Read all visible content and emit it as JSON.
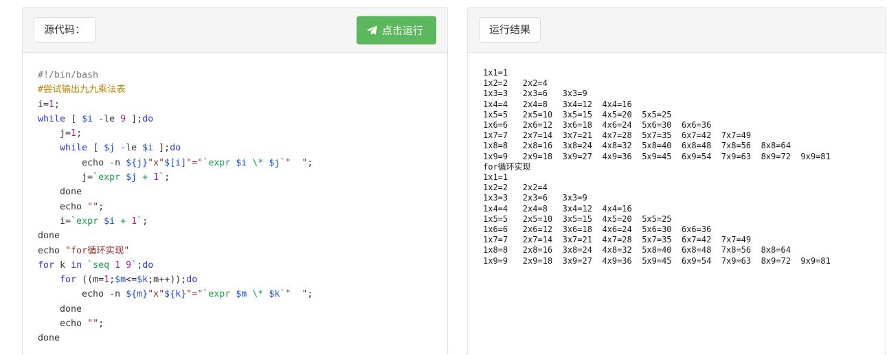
{
  "left_panel": {
    "header_label": "源代码：",
    "run_button": {
      "label": "点击运行",
      "icon": "paper-plane-icon",
      "color": "#5cb85c"
    },
    "code_lines": [
      {
        "indent": 0,
        "tokens": [
          {
            "t": "#!/bin/bash",
            "c": "cm1"
          }
        ]
      },
      {
        "indent": 0,
        "tokens": [
          {
            "t": "#尝试输出九九乘法表",
            "c": "cm"
          }
        ]
      },
      {
        "indent": 0,
        "tokens": [
          {
            "t": "i=",
            "c": "op"
          },
          {
            "t": "1",
            "c": "num"
          },
          {
            "t": ";",
            "c": "op"
          }
        ]
      },
      {
        "indent": 0,
        "tokens": [
          {
            "t": "while",
            "c": "k"
          },
          {
            "t": " [ ",
            "c": "op"
          },
          {
            "t": "$i",
            "c": "var"
          },
          {
            "t": " -le ",
            "c": "op"
          },
          {
            "t": "9",
            "c": "num"
          },
          {
            "t": " ];",
            "c": "op"
          },
          {
            "t": "do",
            "c": "k"
          }
        ]
      },
      {
        "indent": 1,
        "tokens": [
          {
            "t": "j=",
            "c": "op"
          },
          {
            "t": "1",
            "c": "num"
          },
          {
            "t": ";",
            "c": "op"
          }
        ]
      },
      {
        "indent": 1,
        "tokens": [
          {
            "t": "while",
            "c": "k"
          },
          {
            "t": " [ ",
            "c": "op"
          },
          {
            "t": "$j",
            "c": "var"
          },
          {
            "t": " -le ",
            "c": "op"
          },
          {
            "t": "$i",
            "c": "var"
          },
          {
            "t": " ];",
            "c": "op"
          },
          {
            "t": "do",
            "c": "k"
          }
        ]
      },
      {
        "indent": 2,
        "tokens": [
          {
            "t": "echo",
            "c": "op"
          },
          {
            "t": " -n ",
            "c": "op"
          },
          {
            "t": "${j}",
            "c": "var"
          },
          {
            "t": "\"x\"",
            "c": "str"
          },
          {
            "t": "$[i]",
            "c": "var"
          },
          {
            "t": "\"=\"",
            "c": "str"
          },
          {
            "t": "`expr ",
            "c": "bq"
          },
          {
            "t": "$i",
            "c": "var"
          },
          {
            "t": " \\* ",
            "c": "bq"
          },
          {
            "t": "$j",
            "c": "var"
          },
          {
            "t": "`",
            "c": "bq"
          },
          {
            "t": "\"  \"",
            "c": "str"
          },
          {
            "t": ";",
            "c": "op"
          }
        ]
      },
      {
        "indent": 2,
        "tokens": [
          {
            "t": "j=",
            "c": "op"
          },
          {
            "t": "`expr ",
            "c": "bq"
          },
          {
            "t": "$j",
            "c": "var"
          },
          {
            "t": " + ",
            "c": "bq"
          },
          {
            "t": "1",
            "c": "num"
          },
          {
            "t": "`",
            "c": "bq"
          },
          {
            "t": ";",
            "c": "op"
          }
        ]
      },
      {
        "indent": 1,
        "tokens": [
          {
            "t": "done",
            "c": "op"
          }
        ]
      },
      {
        "indent": 1,
        "tokens": [
          {
            "t": "echo",
            "c": "op"
          },
          {
            "t": " ",
            "c": "op"
          },
          {
            "t": "\"\"",
            "c": "str"
          },
          {
            "t": ";",
            "c": "op"
          }
        ]
      },
      {
        "indent": 1,
        "tokens": [
          {
            "t": "i=",
            "c": "op"
          },
          {
            "t": "`expr ",
            "c": "bq"
          },
          {
            "t": "$i",
            "c": "var"
          },
          {
            "t": " + ",
            "c": "bq"
          },
          {
            "t": "1",
            "c": "num"
          },
          {
            "t": "`",
            "c": "bq"
          },
          {
            "t": ";",
            "c": "op"
          }
        ]
      },
      {
        "indent": 0,
        "tokens": [
          {
            "t": "done",
            "c": "op"
          }
        ]
      },
      {
        "indent": 0,
        "tokens": [
          {
            "t": "echo",
            "c": "op"
          },
          {
            "t": " ",
            "c": "op"
          },
          {
            "t": "\"for循环实现\"",
            "c": "str"
          }
        ]
      },
      {
        "indent": 0,
        "tokens": [
          {
            "t": "for",
            "c": "k"
          },
          {
            "t": " k ",
            "c": "op"
          },
          {
            "t": "in",
            "c": "k"
          },
          {
            "t": " ",
            "c": "op"
          },
          {
            "t": "`seq ",
            "c": "bq"
          },
          {
            "t": "1",
            "c": "num"
          },
          {
            "t": " ",
            "c": "bq"
          },
          {
            "t": "9",
            "c": "num"
          },
          {
            "t": "`",
            "c": "bq"
          },
          {
            "t": ";",
            "c": "op"
          },
          {
            "t": "do",
            "c": "k"
          }
        ]
      },
      {
        "indent": 1,
        "tokens": [
          {
            "t": "for",
            "c": "k"
          },
          {
            "t": " ((m=",
            "c": "op"
          },
          {
            "t": "1",
            "c": "num"
          },
          {
            "t": ";",
            "c": "op"
          },
          {
            "t": "$m",
            "c": "var"
          },
          {
            "t": "<=",
            "c": "op"
          },
          {
            "t": "$k",
            "c": "var"
          },
          {
            "t": ";m++));",
            "c": "op"
          },
          {
            "t": "do",
            "c": "k"
          }
        ]
      },
      {
        "indent": 2,
        "tokens": [
          {
            "t": "echo",
            "c": "op"
          },
          {
            "t": " -n ",
            "c": "op"
          },
          {
            "t": "${m}",
            "c": "var"
          },
          {
            "t": "\"x\"",
            "c": "str"
          },
          {
            "t": "${k}",
            "c": "var"
          },
          {
            "t": "\"=\"",
            "c": "str"
          },
          {
            "t": "`expr ",
            "c": "bq"
          },
          {
            "t": "$m",
            "c": "var"
          },
          {
            "t": " \\* ",
            "c": "bq"
          },
          {
            "t": "$k",
            "c": "var"
          },
          {
            "t": "`",
            "c": "bq"
          },
          {
            "t": "\"  \"",
            "c": "str"
          },
          {
            "t": ";",
            "c": "op"
          }
        ]
      },
      {
        "indent": 1,
        "tokens": [
          {
            "t": "done",
            "c": "op"
          }
        ]
      },
      {
        "indent": 1,
        "tokens": [
          {
            "t": "echo",
            "c": "op"
          },
          {
            "t": " ",
            "c": "op"
          },
          {
            "t": "\"\"",
            "c": "str"
          },
          {
            "t": ";",
            "c": "op"
          }
        ]
      },
      {
        "indent": 0,
        "tokens": [
          {
            "t": "done",
            "c": "op"
          }
        ]
      }
    ]
  },
  "right_panel": {
    "header_label": "运行结果",
    "output_lines": [
      "1x1=1",
      "1x2=2   2x2=4",
      "1x3=3   2x3=6   3x3=9",
      "1x4=4   2x4=8   3x4=12  4x4=16",
      "1x5=5   2x5=10  3x5=15  4x5=20  5x5=25",
      "1x6=6   2x6=12  3x6=18  4x6=24  5x6=30  6x6=36",
      "1x7=7   2x7=14  3x7=21  4x7=28  5x7=35  6x7=42  7x7=49",
      "1x8=8   2x8=16  3x8=24  4x8=32  5x8=40  6x8=48  7x8=56  8x8=64",
      "1x9=9   2x9=18  3x9=27  4x9=36  5x9=45  6x9=54  7x9=63  8x9=72  9x9=81",
      "for循环实现",
      "1x1=1",
      "1x2=2   2x2=4",
      "1x3=3   2x3=6   3x3=9",
      "1x4=4   2x4=8   3x4=12  4x4=16",
      "1x5=5   2x5=10  3x5=15  4x5=20  5x5=25",
      "1x6=6   2x6=12  3x6=18  4x6=24  5x6=30  6x6=36",
      "1x7=7   2x7=14  3x7=21  4x7=28  5x7=35  6x7=42  7x7=49",
      "1x8=8   2x8=16  3x8=24  4x8=32  5x8=40  6x8=48  7x8=56  8x8=64",
      "1x9=9   2x9=18  3x9=27  4x9=36  5x9=45  6x9=54  7x9=63  8x9=72  9x9=81"
    ]
  }
}
